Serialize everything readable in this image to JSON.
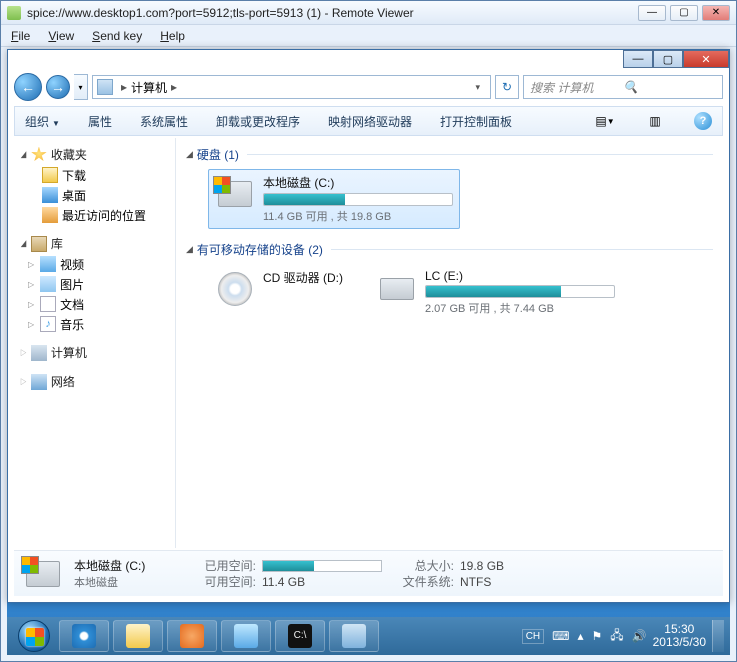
{
  "outer": {
    "title": "spice://www.desktop1.com?port=5912;tls-port=5913 (1) - Remote Viewer",
    "menus": {
      "file": "File",
      "view": "View",
      "sendkey": "Send key",
      "help": "Help"
    }
  },
  "addr": {
    "crumb": "计算机",
    "search_placeholder": "搜索 计算机"
  },
  "toolbar": {
    "organize": "组织",
    "properties": "属性",
    "sysprops": "系统属性",
    "uninstall": "卸载或更改程序",
    "mapdrive": "映射网络驱动器",
    "ctrlpanel": "打开控制面板"
  },
  "sidebar": {
    "favorites": "收藏夹",
    "downloads": "下载",
    "desktop": "桌面",
    "recent": "最近访问的位置",
    "libraries": "库",
    "videos": "视频",
    "pictures": "图片",
    "documents": "文档",
    "music": "音乐",
    "computer": "计算机",
    "network": "网络"
  },
  "sections": {
    "hdd": "硬盘 (1)",
    "removable": "有可移动存储的设备 (2)"
  },
  "drives": {
    "c": {
      "name": "本地磁盘 (C:)",
      "free": "11.4 GB 可用 , 共 19.8 GB",
      "pct": 43
    },
    "d": {
      "name": "CD 驱动器 (D:)"
    },
    "e": {
      "name": "LC (E:)",
      "free": "2.07 GB 可用 , 共 7.44 GB",
      "pct": 72
    }
  },
  "details": {
    "name": "本地磁盘 (C:)",
    "type": "本地磁盘",
    "used_k": "已用空间:",
    "free_k": "可用空间:",
    "free_v": "11.4 GB",
    "total_k": "总大小:",
    "total_v": "19.8 GB",
    "fs_k": "文件系统:",
    "fs_v": "NTFS",
    "pct": 43
  },
  "tray": {
    "lang1": "CH",
    "time": "15:30",
    "date": "2013/5/30"
  }
}
